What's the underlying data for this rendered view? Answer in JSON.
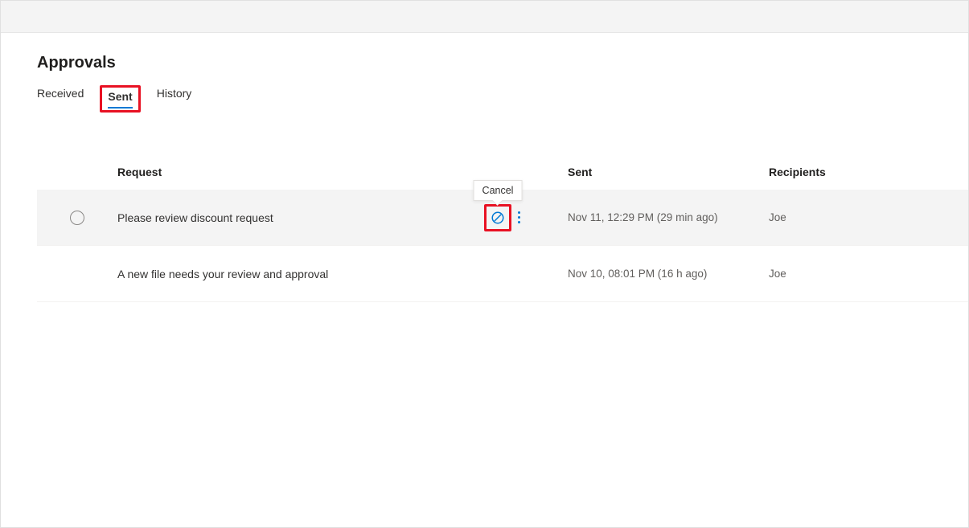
{
  "page_title": "Approvals",
  "tabs": {
    "received": "Received",
    "sent": "Sent",
    "history": "History",
    "active": "sent"
  },
  "columns": {
    "request": "Request",
    "sent": "Sent",
    "recipients": "Recipients"
  },
  "tooltip": {
    "cancel": "Cancel"
  },
  "rows": [
    {
      "request": "Please review discount request",
      "sent": "Nov 11, 12:29 PM (29 min ago)",
      "recipients": "Joe",
      "hovered": true
    },
    {
      "request": "A new file needs your review and approval",
      "sent": "Nov 10, 08:01 PM (16 h ago)",
      "recipients": "Joe",
      "hovered": false
    }
  ]
}
